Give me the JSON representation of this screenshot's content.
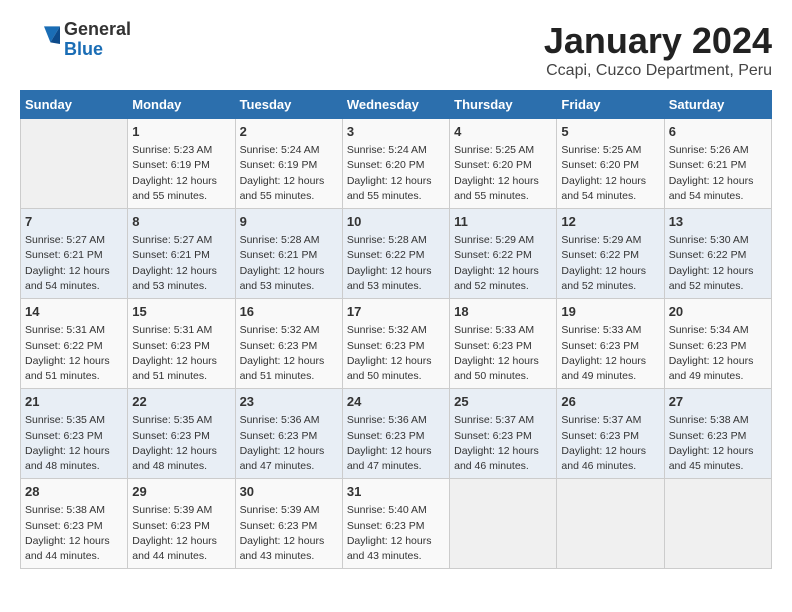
{
  "logo": {
    "general": "General",
    "blue": "Blue"
  },
  "title": "January 2024",
  "subtitle": "Ccapi, Cuzco Department, Peru",
  "days_of_week": [
    "Sunday",
    "Monday",
    "Tuesday",
    "Wednesday",
    "Thursday",
    "Friday",
    "Saturday"
  ],
  "weeks": [
    [
      {
        "day": "",
        "info": ""
      },
      {
        "day": "1",
        "info": "Sunrise: 5:23 AM\nSunset: 6:19 PM\nDaylight: 12 hours\nand 55 minutes."
      },
      {
        "day": "2",
        "info": "Sunrise: 5:24 AM\nSunset: 6:19 PM\nDaylight: 12 hours\nand 55 minutes."
      },
      {
        "day": "3",
        "info": "Sunrise: 5:24 AM\nSunset: 6:20 PM\nDaylight: 12 hours\nand 55 minutes."
      },
      {
        "day": "4",
        "info": "Sunrise: 5:25 AM\nSunset: 6:20 PM\nDaylight: 12 hours\nand 55 minutes."
      },
      {
        "day": "5",
        "info": "Sunrise: 5:25 AM\nSunset: 6:20 PM\nDaylight: 12 hours\nand 54 minutes."
      },
      {
        "day": "6",
        "info": "Sunrise: 5:26 AM\nSunset: 6:21 PM\nDaylight: 12 hours\nand 54 minutes."
      }
    ],
    [
      {
        "day": "7",
        "info": "Sunrise: 5:27 AM\nSunset: 6:21 PM\nDaylight: 12 hours\nand 54 minutes."
      },
      {
        "day": "8",
        "info": "Sunrise: 5:27 AM\nSunset: 6:21 PM\nDaylight: 12 hours\nand 53 minutes."
      },
      {
        "day": "9",
        "info": "Sunrise: 5:28 AM\nSunset: 6:21 PM\nDaylight: 12 hours\nand 53 minutes."
      },
      {
        "day": "10",
        "info": "Sunrise: 5:28 AM\nSunset: 6:22 PM\nDaylight: 12 hours\nand 53 minutes."
      },
      {
        "day": "11",
        "info": "Sunrise: 5:29 AM\nSunset: 6:22 PM\nDaylight: 12 hours\nand 52 minutes."
      },
      {
        "day": "12",
        "info": "Sunrise: 5:29 AM\nSunset: 6:22 PM\nDaylight: 12 hours\nand 52 minutes."
      },
      {
        "day": "13",
        "info": "Sunrise: 5:30 AM\nSunset: 6:22 PM\nDaylight: 12 hours\nand 52 minutes."
      }
    ],
    [
      {
        "day": "14",
        "info": "Sunrise: 5:31 AM\nSunset: 6:22 PM\nDaylight: 12 hours\nand 51 minutes."
      },
      {
        "day": "15",
        "info": "Sunrise: 5:31 AM\nSunset: 6:23 PM\nDaylight: 12 hours\nand 51 minutes."
      },
      {
        "day": "16",
        "info": "Sunrise: 5:32 AM\nSunset: 6:23 PM\nDaylight: 12 hours\nand 51 minutes."
      },
      {
        "day": "17",
        "info": "Sunrise: 5:32 AM\nSunset: 6:23 PM\nDaylight: 12 hours\nand 50 minutes."
      },
      {
        "day": "18",
        "info": "Sunrise: 5:33 AM\nSunset: 6:23 PM\nDaylight: 12 hours\nand 50 minutes."
      },
      {
        "day": "19",
        "info": "Sunrise: 5:33 AM\nSunset: 6:23 PM\nDaylight: 12 hours\nand 49 minutes."
      },
      {
        "day": "20",
        "info": "Sunrise: 5:34 AM\nSunset: 6:23 PM\nDaylight: 12 hours\nand 49 minutes."
      }
    ],
    [
      {
        "day": "21",
        "info": "Sunrise: 5:35 AM\nSunset: 6:23 PM\nDaylight: 12 hours\nand 48 minutes."
      },
      {
        "day": "22",
        "info": "Sunrise: 5:35 AM\nSunset: 6:23 PM\nDaylight: 12 hours\nand 48 minutes."
      },
      {
        "day": "23",
        "info": "Sunrise: 5:36 AM\nSunset: 6:23 PM\nDaylight: 12 hours\nand 47 minutes."
      },
      {
        "day": "24",
        "info": "Sunrise: 5:36 AM\nSunset: 6:23 PM\nDaylight: 12 hours\nand 47 minutes."
      },
      {
        "day": "25",
        "info": "Sunrise: 5:37 AM\nSunset: 6:23 PM\nDaylight: 12 hours\nand 46 minutes."
      },
      {
        "day": "26",
        "info": "Sunrise: 5:37 AM\nSunset: 6:23 PM\nDaylight: 12 hours\nand 46 minutes."
      },
      {
        "day": "27",
        "info": "Sunrise: 5:38 AM\nSunset: 6:23 PM\nDaylight: 12 hours\nand 45 minutes."
      }
    ],
    [
      {
        "day": "28",
        "info": "Sunrise: 5:38 AM\nSunset: 6:23 PM\nDaylight: 12 hours\nand 44 minutes."
      },
      {
        "day": "29",
        "info": "Sunrise: 5:39 AM\nSunset: 6:23 PM\nDaylight: 12 hours\nand 44 minutes."
      },
      {
        "day": "30",
        "info": "Sunrise: 5:39 AM\nSunset: 6:23 PM\nDaylight: 12 hours\nand 43 minutes."
      },
      {
        "day": "31",
        "info": "Sunrise: 5:40 AM\nSunset: 6:23 PM\nDaylight: 12 hours\nand 43 minutes."
      },
      {
        "day": "",
        "info": ""
      },
      {
        "day": "",
        "info": ""
      },
      {
        "day": "",
        "info": ""
      }
    ]
  ]
}
